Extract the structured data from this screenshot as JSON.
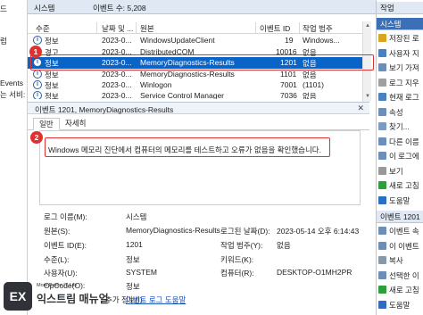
{
  "left_tree": [
    "드",
    "럼",
    "",
    "",
    "Events",
    "는 서비:"
  ],
  "list_header": {
    "title": "시스템",
    "count_label": "이벤트 수: 5,208"
  },
  "columns": [
    "수준",
    "날짜 및 ...",
    "원본",
    "이벤트 ID",
    "작업 범주"
  ],
  "events": [
    {
      "level": "정보",
      "level_icon": "info-icon",
      "date": "2023-0...",
      "source": "WindowsUpdateClient",
      "id": "19",
      "category": "Windows..."
    },
    {
      "level": "경고",
      "level_icon": "warning-icon",
      "date": "2023-0...",
      "source": "DistributedCOM",
      "id": "10016",
      "category": "없음"
    },
    {
      "level": "정보",
      "level_icon": "info-icon",
      "date": "2023-0...",
      "source": "MemoryDiagnostics-Results",
      "id": "1201",
      "category": "없음"
    },
    {
      "level": "정보",
      "level_icon": "info-icon",
      "date": "2023-0...",
      "source": "MemoryDiagnostics-Results",
      "id": "1101",
      "category": "없음"
    },
    {
      "level": "정보",
      "level_icon": "info-icon",
      "date": "2023-0...",
      "source": "Winlogon",
      "id": "7001",
      "category": "(1101)"
    },
    {
      "level": "정보",
      "level_icon": "info-icon",
      "date": "2023-0...",
      "source": "Service Control Manager",
      "id": "7036",
      "category": "없음"
    }
  ],
  "badge1": "1",
  "badge2": "2",
  "detail": {
    "header": "이벤트 1201, MemoryDiagnostics-Results",
    "tabs": [
      "일반",
      "자세히"
    ],
    "description": "Windows 메모리 진단에서 컴퓨터의 메모리를 테스트하고 오류가 없음을 확인했습니다.",
    "props": {
      "log_name_label": "로그 이름(M):",
      "log_name": "시스템",
      "source_label": "원본(S):",
      "source": "MemoryDiagnostics-Results",
      "logged_label": "로그된 날짜(D):",
      "logged": "2023-05-14 오후 6:14:43",
      "event_id_label": "이벤트 ID(E):",
      "event_id": "1201",
      "task_label": "작업 범주(Y):",
      "task": "없음",
      "level_label": "수준(L):",
      "level": "정보",
      "keywords_label": "키워드(K):",
      "keywords": "",
      "user_label": "사용자(U):",
      "user": "SYSTEM",
      "computer_label": "컴퓨터(R):",
      "computer": "DESKTOP-O1MH2PR",
      "opcode_label": "OpCode(O):",
      "opcode": "정보",
      "more_info_label": "추가 정보(I):",
      "more_info_link": "이벤트 로그 도움말"
    }
  },
  "actions": {
    "header": "작업",
    "section1": "시스템",
    "items1": [
      {
        "label": "저장된 로",
        "icon": "folder-icon",
        "color": "#d9a520"
      },
      {
        "label": "사용자 지",
        "icon": "filter-icon",
        "color": "#4a7fc1"
      },
      {
        "label": "보기 가져",
        "icon": "import-icon",
        "color": "#6b8fb8"
      },
      {
        "label": "로그 지우",
        "icon": "clear-icon",
        "color": "#a0a0a0"
      },
      {
        "label": "현재 로그",
        "icon": "filter-icon",
        "color": "#4a7fc1"
      },
      {
        "label": "속성",
        "icon": "properties-icon",
        "color": "#6b8fb8"
      },
      {
        "label": "찾기...",
        "icon": "find-icon",
        "color": "#7a9cc6"
      },
      {
        "label": "다른 이름",
        "icon": "save-icon",
        "color": "#6b8fb8"
      },
      {
        "label": "이 로그에",
        "icon": "task-icon",
        "color": "#6b8fb8"
      },
      {
        "label": "보기",
        "icon": "view-icon",
        "color": "#999999"
      },
      {
        "label": "새로 고침",
        "icon": "refresh-icon",
        "color": "#2e9e3a"
      },
      {
        "label": "도움말",
        "icon": "help-icon",
        "color": "#2b6fc4"
      }
    ],
    "section2": "이벤트 1201",
    "items2": [
      {
        "label": "이벤트 속",
        "icon": "properties-icon",
        "color": "#6b8fb8"
      },
      {
        "label": "이 이벤트",
        "icon": "task-icon",
        "color": "#6b8fb8"
      },
      {
        "label": "복사",
        "icon": "copy-icon",
        "color": "#8899aa"
      },
      {
        "label": "선택한 이",
        "icon": "save-icon",
        "color": "#6b8fb8"
      },
      {
        "label": "새로 고침",
        "icon": "refresh-icon",
        "color": "#2e9e3a"
      },
      {
        "label": "도움말",
        "icon": "help-icon",
        "color": "#2b6fc4"
      }
    ]
  },
  "logo": {
    "mark": "EX",
    "tagline": "More Better IT Life",
    "name": "익스트림 매뉴얼"
  },
  "colors": {
    "selected_row": "#0a64c8",
    "annotation_red": "#e03131",
    "header_bar": "#dfe8f3"
  }
}
